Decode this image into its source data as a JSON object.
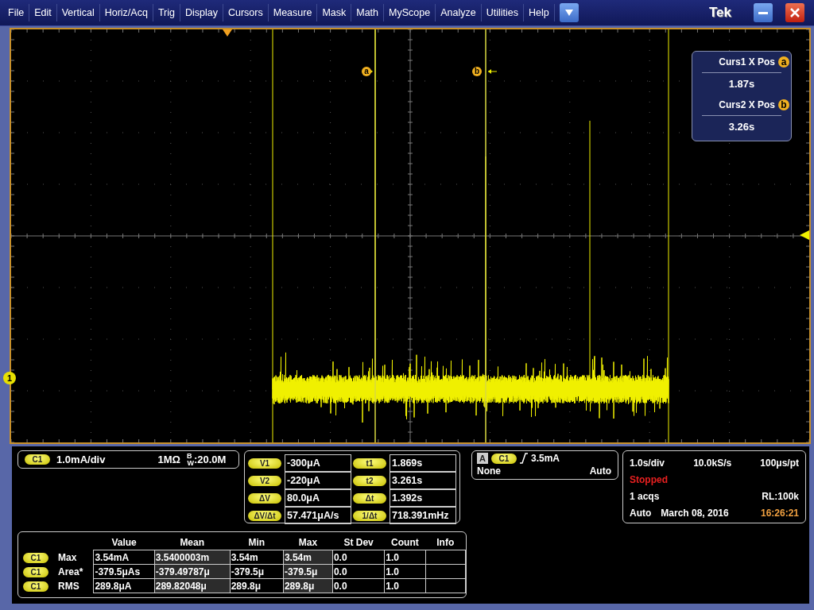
{
  "menu": {
    "items": [
      "File",
      "Edit",
      "Vertical",
      "Horiz/Acq",
      "Trig",
      "Display",
      "Cursors",
      "Measure",
      "Mask",
      "Math",
      "MyScope",
      "Analyze",
      "Utilities",
      "Help"
    ],
    "logo": "Tek"
  },
  "scope": {
    "cursor_markers": [
      "a",
      "b"
    ],
    "channel_marker": "1",
    "cursor_readout": [
      {
        "title": "Curs1 X Pos",
        "marker": "a",
        "value": "1.87s"
      },
      {
        "title": "Curs2 X Pos",
        "marker": "b",
        "value": "3.26s"
      }
    ]
  },
  "channel": {
    "badge": "C1",
    "scale": "1.0mA/div",
    "impedance": "1MΩ",
    "bandwidth": "$^{B}$$_{W}$:20.0M"
  },
  "cursor_values": [
    {
      "badge": "V1",
      "value": "-300μA"
    },
    {
      "badge": "t1",
      "value": "1.869s"
    },
    {
      "badge": "V2",
      "value": "-220μA"
    },
    {
      "badge": "t2",
      "value": "3.261s"
    },
    {
      "badge": "ΔV",
      "value": "80.0μA"
    },
    {
      "badge": "Δt",
      "value": "1.392s"
    },
    {
      "badge": "ΔV/Δt",
      "value": "57.471μA/s"
    },
    {
      "badge": "1/Δt",
      "value": "718.391mHz"
    }
  ],
  "trigger": {
    "type_label": "A",
    "badge": "C1",
    "threshold": "3.5mA",
    "coupling": "None",
    "mode": "Auto"
  },
  "acquisition": {
    "horizontal_scale": "1.0s/div",
    "sample_rate": "10.0kS/s",
    "resolution": "100μs/pt",
    "run_state": {
      "text": "Stopped",
      "kind": "stopped"
    },
    "acqs": "1 acqs",
    "record_length": "RL:100k",
    "mode": "Auto",
    "date": "March 08, 2016",
    "time": "16:26:21"
  },
  "measurements": {
    "columns": [
      {
        "label": "Value",
        "shaded": false
      },
      {
        "label": "Mean",
        "shaded": true
      },
      {
        "label": "Min",
        "shaded": false
      },
      {
        "label": "Max",
        "shaded": true
      },
      {
        "label": "St Dev",
        "shaded": false
      },
      {
        "label": "Count",
        "shaded": false
      },
      {
        "label": "Info",
        "shaded": false
      }
    ],
    "rows": [
      {
        "badge": "C1",
        "name": "Max",
        "cells": [
          "3.54mA",
          "3.5400003m",
          "3.54m",
          "3.54m",
          "0.0",
          "1.0",
          null
        ]
      },
      {
        "badge": "C1",
        "name": "Area*",
        "cells": [
          "-379.5μAs",
          "-379.49787μ",
          "-379.5μ",
          "-379.5μ",
          "0.0",
          "1.0",
          null
        ]
      },
      {
        "badge": "C1",
        "name": "RMS",
        "cells": [
          "289.8μA",
          "289.82048μ",
          "289.8μ",
          "289.8μ",
          "0.0",
          "1.0",
          null
        ]
      }
    ]
  }
}
